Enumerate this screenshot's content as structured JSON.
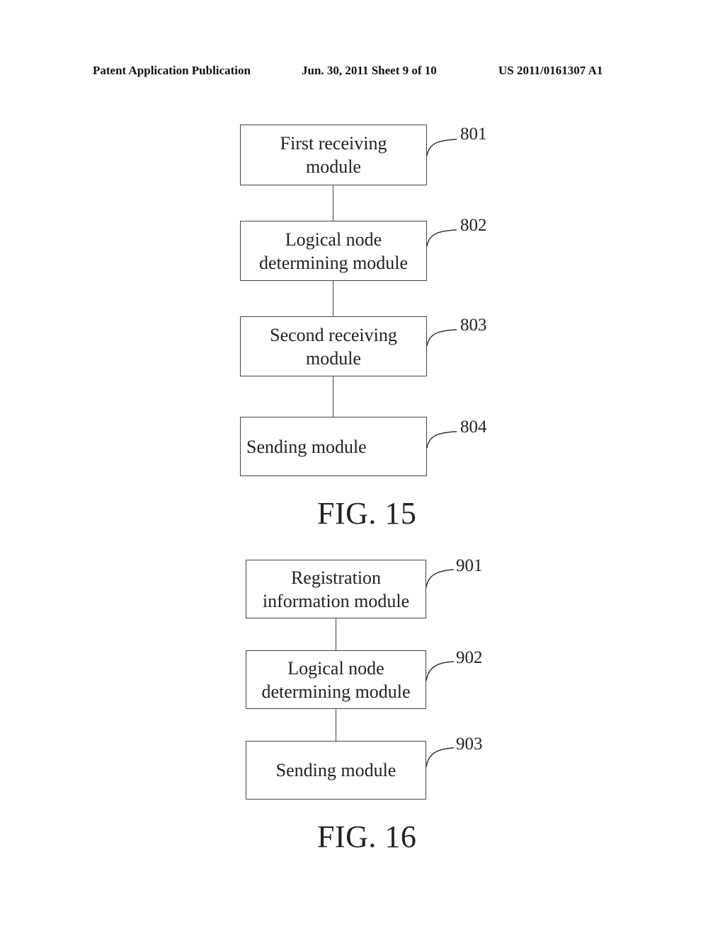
{
  "header": {
    "publication": "Patent Application Publication",
    "date_sheet": "Jun. 30, 2011  Sheet 9 of 10",
    "number": "US 2011/0161307 A1"
  },
  "fig15": {
    "label": "FIG. 15",
    "modules": [
      {
        "line1": "First receiving",
        "line2": "module",
        "ref": "801"
      },
      {
        "line1": "Logical node",
        "line2": "determining module",
        "ref": "802"
      },
      {
        "line1": "Second receiving",
        "line2": "module",
        "ref": "803"
      },
      {
        "line1": "Sending module",
        "line2": "",
        "ref": "804"
      }
    ]
  },
  "fig16": {
    "label": "FIG. 16",
    "modules": [
      {
        "line1": "Registration",
        "line2": "information module",
        "ref": "901"
      },
      {
        "line1": "Logical node",
        "line2": "determining module",
        "ref": "902"
      },
      {
        "line1": "Sending module",
        "line2": "",
        "ref": "903"
      }
    ]
  }
}
